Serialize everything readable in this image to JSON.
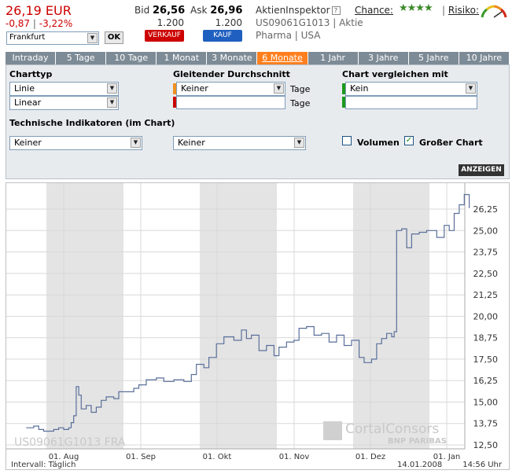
{
  "quote": {
    "price": "26,19 EUR",
    "change_abs": "-0,87",
    "change_sep": "|",
    "change_pct": "-3,22%",
    "bid_label": "Bid",
    "bid": "26,56",
    "ask_label": "Ask",
    "ask": "26,96",
    "bid_qty": "1.200",
    "ask_qty": "1.200",
    "sell_label": "VERKAUF",
    "buy_label": "KAUF",
    "exchange": "Frankfurt",
    "ok_label": "OK"
  },
  "info": {
    "inspector": "AktienInspektor",
    "help": "?",
    "isin_line": "US09061G1013 | Aktie",
    "sector_line": "Pharma | USA",
    "chance_label": "Chance:",
    "chance_stars": "★★★★",
    "risiko_label": "Risiko:"
  },
  "tabs": [
    "Intraday",
    "5 Tage",
    "10 Tage",
    "1 Monat",
    "3 Monate",
    "6 Monate",
    "1 Jahr",
    "3 Jahre",
    "5 Jahre",
    "10 Jahre"
  ],
  "active_tab": "6 Monate",
  "settings": {
    "charttyp_label": "Charttyp",
    "charttyp_value": "Linie",
    "scale_value": "Linear",
    "ma_label": "Gleitender Durchschnitt",
    "ma_value": "Keiner",
    "tage_label": "Tage",
    "compare_label": "Chart vergleichen mit",
    "compare_value": "Kein",
    "indicators_label": "Technische Indikatoren (im Chart)",
    "ind1_value": "Keiner",
    "ind2_value": "Keiner",
    "volumen_label": "Volumen",
    "volumen_checked": false,
    "grosser_label": "Großer Chart",
    "grosser_checked": true,
    "show_label": "ANZEIGEN"
  },
  "colors": {
    "price_red": "#cc0000",
    "tab_gray": "#7d8b96",
    "tab_active": "#ff7f1e",
    "line": "#5a6f9a",
    "shade": "#e4e4e4"
  },
  "chart_data": {
    "type": "line",
    "x_ticks": [
      "01. Aug",
      "01. Sep",
      "01. Okt",
      "01. Nov",
      "01. Dez",
      "01. Jan"
    ],
    "y_ticks": [
      "26,25",
      "25,00",
      "23,75",
      "22,50",
      "21,25",
      "20,00",
      "18,75",
      "17,50",
      "16,25",
      "15,00",
      "13,75",
      "12,50"
    ],
    "ylim": [
      12.5,
      27.0
    ],
    "grid": true,
    "shaded_months": [
      "Aug",
      "Okt",
      "Dez"
    ],
    "watermark_left": "US09061G1013   FRA",
    "watermark_brand": "CortalConsors",
    "watermark_brand2": "BNP PARIBAS",
    "interval_label": "Intervall: Täglich",
    "footer_date": "14.01.2008",
    "footer_time": "14:56 Uhr",
    "series": [
      {
        "values": [
          [
            -15,
            13.5
          ],
          [
            -12,
            13.6
          ],
          [
            -10,
            13.4
          ],
          [
            -8,
            13.3
          ],
          [
            -6,
            13.3
          ],
          [
            -4,
            13.4
          ],
          [
            -2,
            13.5
          ],
          [
            0,
            13.4
          ],
          [
            2,
            13.5
          ],
          [
            3,
            13.8
          ],
          [
            4,
            14.2
          ],
          [
            5,
            15.9
          ],
          [
            6,
            15.4
          ],
          [
            7,
            14.6
          ],
          [
            9,
            14.8
          ],
          [
            11,
            14.4
          ],
          [
            13,
            14.7
          ],
          [
            15,
            15.1
          ],
          [
            17,
            15.3
          ],
          [
            20,
            15.2
          ],
          [
            22,
            15.6
          ],
          [
            25,
            15.6
          ],
          [
            28,
            15.8
          ],
          [
            30,
            16.0
          ],
          [
            33,
            16.3
          ],
          [
            37,
            16.4
          ],
          [
            40,
            16.2
          ],
          [
            44,
            16.3
          ],
          [
            48,
            16.2
          ],
          [
            51,
            16.6
          ],
          [
            53,
            17.2
          ],
          [
            56,
            17.0
          ],
          [
            58,
            17.6
          ],
          [
            61,
            18.4
          ],
          [
            64,
            18.8
          ],
          [
            68,
            18.6
          ],
          [
            71,
            19.2
          ],
          [
            73,
            18.7
          ],
          [
            75,
            18.9
          ],
          [
            78,
            18.0
          ],
          [
            81,
            18.3
          ],
          [
            84,
            17.7
          ],
          [
            86,
            18.2
          ],
          [
            89,
            18.5
          ],
          [
            92,
            18.6
          ],
          [
            94,
            19.3
          ],
          [
            97,
            19.4
          ],
          [
            100,
            18.9
          ],
          [
            103,
            19.0
          ],
          [
            106,
            18.5
          ],
          [
            109,
            18.9
          ],
          [
            112,
            18.3
          ],
          [
            115,
            18.6
          ],
          [
            118,
            17.6
          ],
          [
            120,
            17.3
          ],
          [
            123,
            17.5
          ],
          [
            125,
            18.4
          ],
          [
            127,
            18.7
          ],
          [
            129,
            19.0
          ],
          [
            131,
            18.8
          ],
          [
            132,
            19.1
          ],
          [
            133,
            25.0
          ],
          [
            135,
            25.1
          ],
          [
            137,
            24.0
          ],
          [
            139,
            24.8
          ],
          [
            142,
            24.9
          ],
          [
            145,
            25.0
          ],
          [
            149,
            24.6
          ],
          [
            152,
            25.3
          ],
          [
            154,
            25.0
          ],
          [
            156,
            26.0
          ],
          [
            158,
            26.5
          ],
          [
            160,
            27.1
          ],
          [
            162,
            26.3
          ]
        ]
      }
    ]
  }
}
